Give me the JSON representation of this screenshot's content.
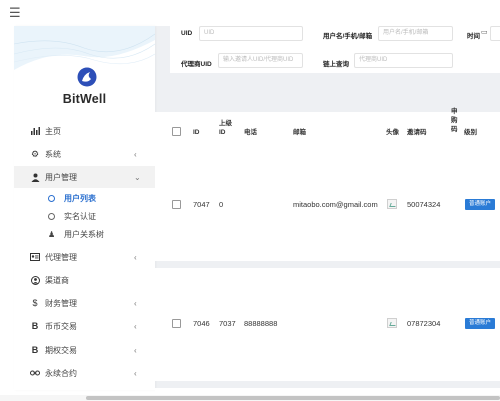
{
  "header": {
    "menu_icon": "hamburger-icon"
  },
  "brand": {
    "name": "BitWell",
    "logo_icon": "bitwell-logo-icon"
  },
  "sidebar": {
    "items": [
      {
        "key": "home",
        "label": "主页",
        "icon": "bar-chart-icon",
        "has_chevron": false
      },
      {
        "key": "system",
        "label": "系统",
        "icon": "gear-icon",
        "has_chevron": true
      },
      {
        "key": "user-mgmt",
        "label": "用户管理",
        "icon": "user-group-icon",
        "has_chevron": true,
        "expanded": true
      },
      {
        "key": "agent-mgmt",
        "label": "代理管理",
        "icon": "id-card-icon",
        "has_chevron": true
      },
      {
        "key": "channel",
        "label": "渠道商",
        "icon": "user-circle-icon",
        "has_chevron": false
      },
      {
        "key": "finance",
        "label": "财务管理",
        "icon": "dollar-icon",
        "has_chevron": true
      },
      {
        "key": "coin-trade",
        "label": "币币交易",
        "icon": "bitcoin-icon",
        "has_chevron": true
      },
      {
        "key": "options",
        "label": "期权交易",
        "icon": "bitcoin-icon",
        "has_chevron": true
      },
      {
        "key": "perpetual",
        "label": "永续合约",
        "icon": "link-icon",
        "has_chevron": true
      }
    ],
    "user_subitems": [
      {
        "label": "用户列表",
        "selected": true
      },
      {
        "label": "实名认证",
        "selected": false
      },
      {
        "label": "用户关系树",
        "selected": false
      }
    ]
  },
  "filters": {
    "uid_label": "UID",
    "uid_placeholder": "UID",
    "name_label": "用户名/手机/邮箱",
    "name_placeholder": "用户名/手机/邮箱",
    "time_label": "时间",
    "agent_label": "代理商UID",
    "agent_placeholder": "输入邀请人UID/代理商UID",
    "chain_label": "链上查询",
    "chain_placeholder": "代理商UID"
  },
  "table": {
    "columns": {
      "id": "ID",
      "parent_id_line1": "上级",
      "parent_id_line2": "ID",
      "phone": "电话",
      "email": "邮箱",
      "avatar": "头像",
      "invite_code": "邀请码",
      "agent_code_1": "申",
      "agent_code_2": "购",
      "agent_code_3": "码",
      "level": "级别"
    },
    "rows": [
      {
        "id": "7047",
        "parent_id": "0",
        "phone": "",
        "email": "mitaobo.com@gmail.com",
        "invite_code": "50074324",
        "level": "普通账户"
      },
      {
        "id": "7046",
        "parent_id": "7037",
        "phone": "88888888",
        "email": "",
        "invite_code": "07872304",
        "level": "普通账户"
      }
    ]
  },
  "colors": {
    "accent": "#2a7bd6",
    "selected_text": "#2a6fcf",
    "content_bg": "#eef0f3"
  }
}
